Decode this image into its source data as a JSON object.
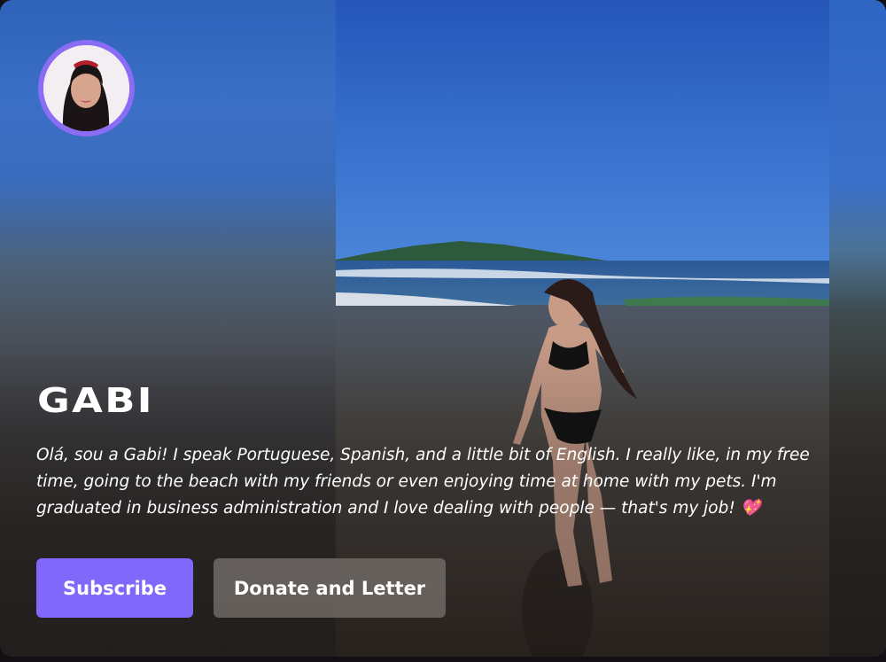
{
  "profile": {
    "name": "GABI",
    "bio": "Olá, sou a Gabi! I speak Portuguese, Spanish, and a little bit of English. I really like, in my free time, going to the beach with my friends or even enjoying time at home with my pets. I'm graduated in business administration and I love dealing with people — that's my job! 💖",
    "avatar_icon": "profile-avatar",
    "photo_icon": "beach-photo"
  },
  "actions": {
    "subscribe_label": "Subscribe",
    "donate_label": "Donate and Letter"
  },
  "colors": {
    "accent": "#8069fa",
    "secondary_button": "#706a66",
    "avatar_ring": "#8b6cf5"
  }
}
